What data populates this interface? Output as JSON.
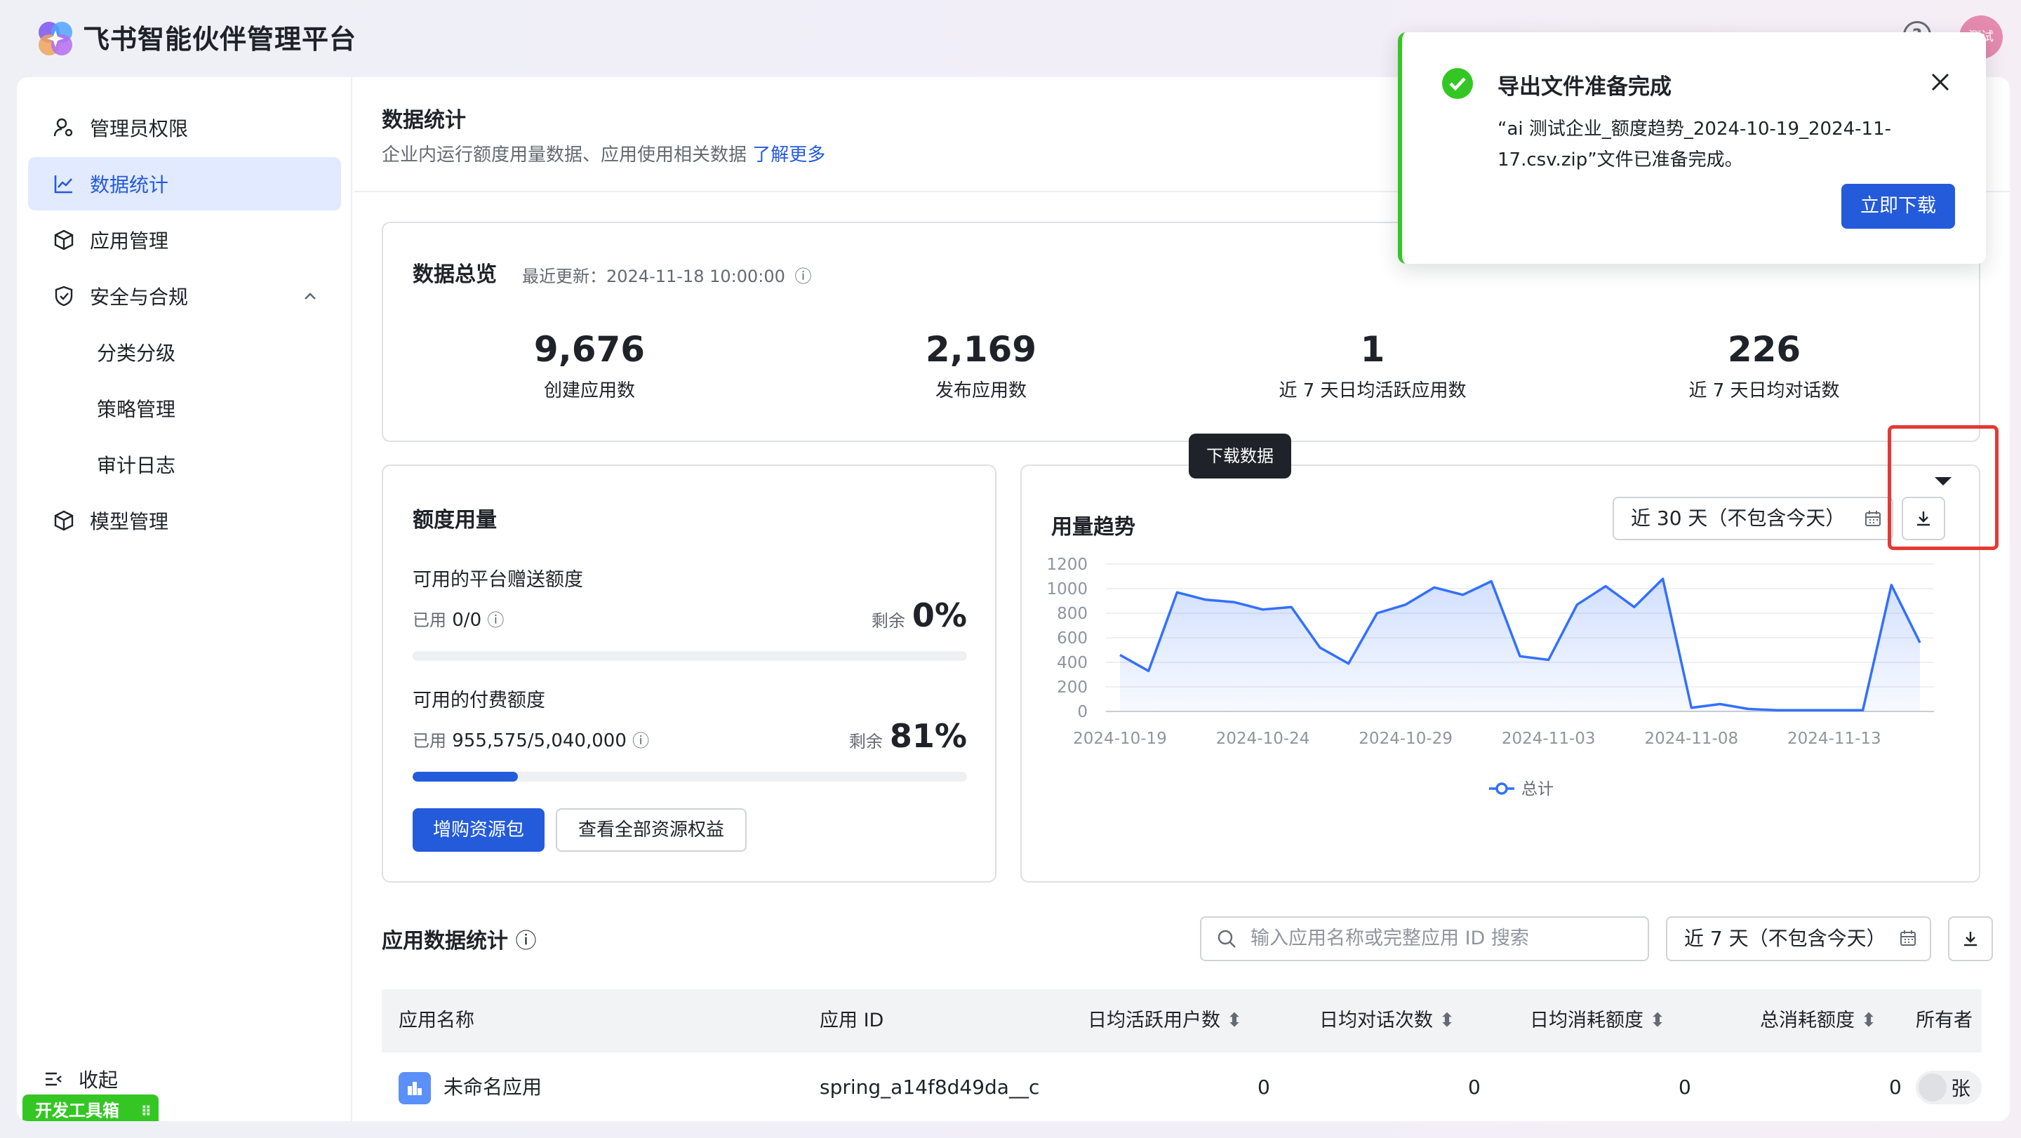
{
  "app": {
    "title": "飞书智能伙伴管理平台",
    "avatar_text": "测试"
  },
  "sidebar": {
    "items": [
      {
        "label": "管理员权限",
        "icon": "admin-user-icon"
      },
      {
        "label": "数据统计",
        "icon": "line-chart-icon",
        "active": true
      },
      {
        "label": "应用管理",
        "icon": "cube-icon"
      },
      {
        "label": "安全与合规",
        "icon": "shield-icon"
      },
      {
        "label": "分类分级"
      },
      {
        "label": "策略管理"
      },
      {
        "label": "审计日志"
      },
      {
        "label": "模型管理",
        "icon": "cube-icon"
      }
    ],
    "collapse_label": "收起",
    "devtools_label": "开发工具箱"
  },
  "page": {
    "title": "数据统计",
    "desc": "企业内运行额度用量数据、应用使用相关数据",
    "learn_more": "了解更多"
  },
  "overview": {
    "title": "数据总览",
    "updated": "最近更新：2024-11-18 10:00:00",
    "metrics": [
      {
        "value": "9,676",
        "label": "创建应用数"
      },
      {
        "value": "2,169",
        "label": "发布应用数"
      },
      {
        "value": "1",
        "label": "近 7 天日均活跃应用数"
      },
      {
        "value": "226",
        "label": "近 7 天日均对话数"
      }
    ]
  },
  "quota": {
    "title": "额度用量",
    "free": {
      "title": "可用的平台赠送额度",
      "used_label": "已用",
      "used": "0/0",
      "remain_label": "剩余",
      "remain": "0%",
      "used_fraction": 0
    },
    "paid": {
      "title": "可用的付费额度",
      "used_label": "已用",
      "used": "955,575/5,040,000",
      "remain_label": "剩余",
      "remain": "81%",
      "used_fraction": 0.19
    },
    "buy_button": "增购资源包",
    "view_button": "查看全部资源权益"
  },
  "trend": {
    "title": "用量趋势",
    "range": "近 30 天（不包含今天）",
    "download_tooltip": "下载数据"
  },
  "chart_data": {
    "type": "area",
    "series": [
      {
        "name": "总计",
        "values": [
          460,
          330,
          970,
          910,
          890,
          830,
          850,
          520,
          390,
          800,
          870,
          1010,
          950,
          1060,
          450,
          420,
          870,
          1020,
          850,
          1080,
          30,
          60,
          20,
          10,
          10,
          10,
          10,
          1030,
          560
        ]
      }
    ],
    "x_ticks": [
      "2024-10-19",
      "2024-10-24",
      "2024-10-29",
      "2024-11-03",
      "2024-11-08",
      "2024-11-13"
    ],
    "y_ticks": [
      0,
      200,
      400,
      600,
      800,
      1000,
      1200
    ],
    "ylim": [
      0,
      1200
    ],
    "legend": "bottom",
    "color": "#3370ff"
  },
  "appstats": {
    "title": "应用数据统计",
    "search_placeholder": "输入应用名称或完整应用 ID 搜索",
    "range": "近 7 天（不包含今天）",
    "columns": [
      "应用名称",
      "应用 ID",
      "日均活跃用户数",
      "日均对话次数",
      "日均消耗额度",
      "总消耗额度",
      "所有者"
    ],
    "rows": [
      {
        "name": "未命名应用",
        "id": "spring_a14f8d49da__c",
        "dau": "0",
        "dialogs": "0",
        "daily_quota": "0",
        "total_quota": "0",
        "owner": "张"
      }
    ]
  },
  "toast": {
    "title": "导出文件准备完成",
    "body_line1": "“ai 测试企业_额度趋势_2024-10-19_2024-11-",
    "body_line2": "17.csv.zip”文件已准备完成。",
    "button": "立即下载"
  }
}
